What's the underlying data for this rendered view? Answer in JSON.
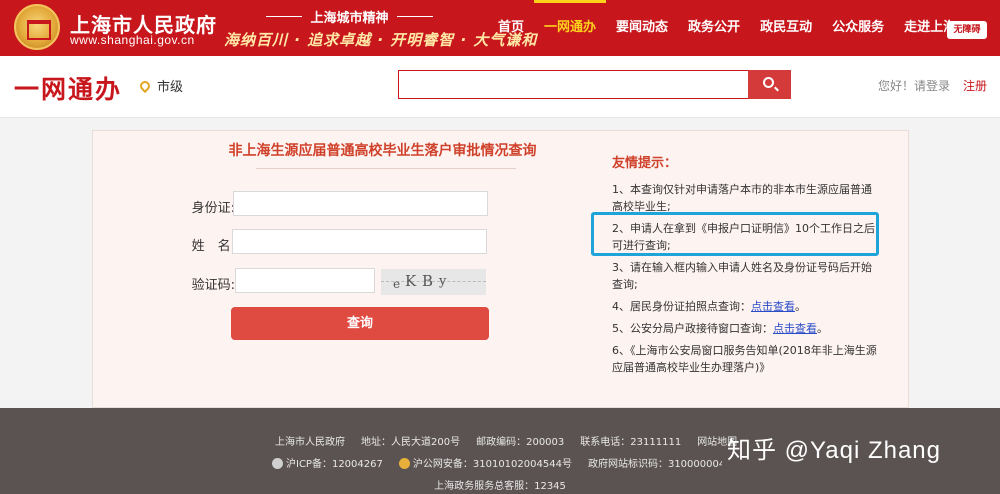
{
  "header": {
    "site_title": "上海市人民政府",
    "site_url": "www.shanghai.gov.cn",
    "spirit_title": "上海城市精神",
    "spirit_slogan": "海纳百川 · 追求卓越 · 开明睿智 · 大气谦和",
    "nav": [
      {
        "label": "首页",
        "active": false
      },
      {
        "label": "一网通办",
        "active": true
      },
      {
        "label": "要闻动态",
        "active": false
      },
      {
        "label": "政务公开",
        "active": false
      },
      {
        "label": "政民互动",
        "active": false
      },
      {
        "label": "公众服务",
        "active": false
      },
      {
        "label": "走进上海",
        "active": false
      }
    ],
    "barrier_free": "无障碍"
  },
  "subheader": {
    "brand": "一网通办",
    "location": "市级",
    "search_placeholder": "",
    "login_text": "您好！请登录",
    "register_text": "注册"
  },
  "form": {
    "title": "非上海生源应届普通高校毕业生落户审批情况查询",
    "id_label": "身份证:",
    "name_label": "姓　名:",
    "captcha_label": "验证码:",
    "captcha_text": [
      "e",
      "K",
      "B",
      "y"
    ],
    "submit_label": "查询"
  },
  "tips": {
    "title": "友情提示：",
    "items": [
      {
        "text": "1、本查询仅针对申请落户本市的非本市生源应届普通高校毕业生;"
      },
      {
        "text": "2、申请人在拿到《申报户口证明信》10个工作日之后可进行查询;"
      },
      {
        "text": "3、请在输入框内输入申请人姓名及身份证号码后开始查询;"
      },
      {
        "text": "4、居民身份证拍照点查询：",
        "link": "点击查看",
        "suffix": "。"
      },
      {
        "text": "5、公安分局户政接待窗口查询：",
        "link": "点击查看",
        "suffix": "。"
      },
      {
        "text": "6、《上海市公安局窗口服务告知单(2018年非上海生源应届普通高校毕业生办理落户)》"
      }
    ]
  },
  "footer": {
    "row1": [
      "上海市人民政府",
      "地址：人民大道200号",
      "邮政编码：200003",
      "联系电话：23111111",
      "网站地图"
    ],
    "icp": "沪ICP备：12004267",
    "police": "沪公网安备：31010102004544号",
    "site_code": "政府网站标识码：3100000044",
    "hotline": "上海政务服务总客服：12345",
    "watermark": "知乎 @Yaqi Zhang"
  },
  "colors": {
    "brand_red": "#c7161c",
    "highlight_blue": "#1fa4d9",
    "link_blue": "#2a4cc9"
  }
}
